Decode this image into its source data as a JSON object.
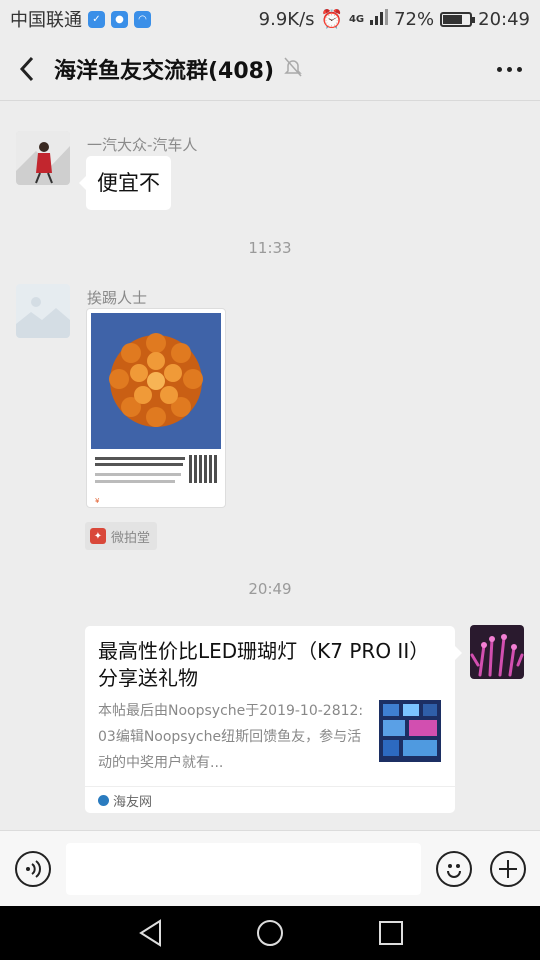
{
  "status_bar": {
    "carrier": "中国联通",
    "speed": "9.9K/s",
    "network": "4G",
    "battery": "72%",
    "battery_level": 0.72,
    "time": "20:49"
  },
  "header": {
    "title": "海洋鱼友交流群(408)"
  },
  "messages": {
    "m1": {
      "sender": "一汽大众-汽车人",
      "text": "便宜不"
    },
    "ts1": "11:33",
    "m2": {
      "sender": "挨踢人士",
      "source_label": "微拍堂"
    },
    "ts2": "20:49",
    "m3": {
      "title": "最高性价比LED珊瑚灯（K7 PRO II）分享送礼物",
      "desc": "本帖最后由Noopsyche于2019-10-2812:03编辑Noopsyche纽斯回馈鱼友，参与活动的中奖用户就有...",
      "source": "海友网"
    }
  },
  "colors": {
    "background": "#ededed",
    "bubble": "#ffffff",
    "timestamp": "#9a9a9a"
  }
}
